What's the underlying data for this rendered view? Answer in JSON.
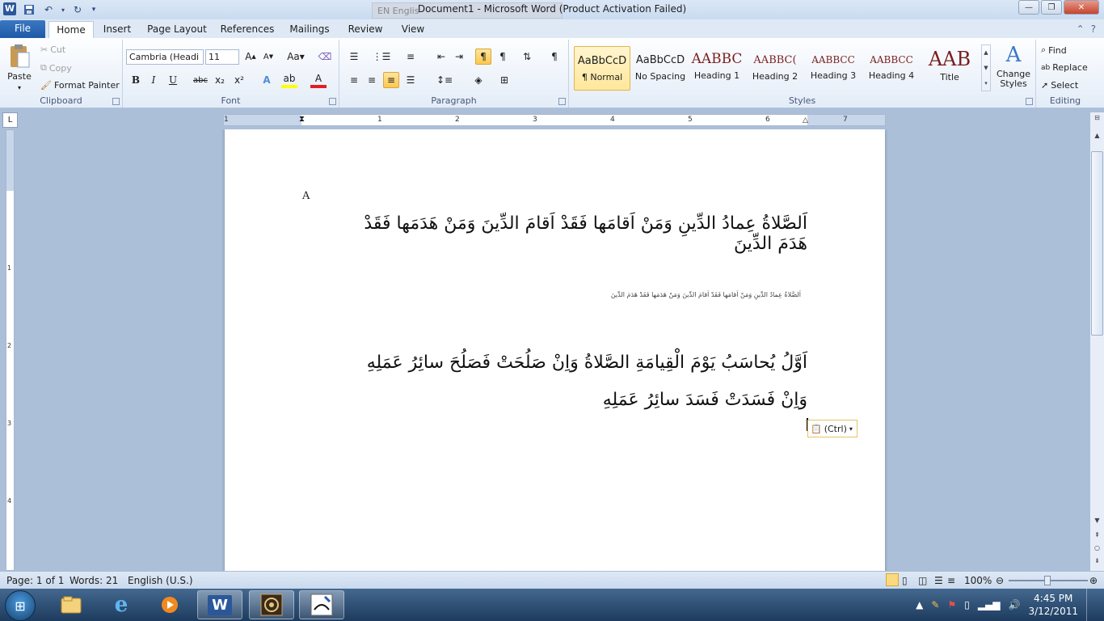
{
  "window": {
    "title": "Document1  -  Microsoft Word (Product Activation Failed)",
    "app_icon_letter": "W",
    "langbar_text": "EN Englis"
  },
  "tabs": [
    "File",
    "Home",
    "Insert",
    "Page Layout",
    "References",
    "Mailings",
    "Review",
    "View"
  ],
  "ribbon": {
    "clipboard": {
      "label": "Clipboard",
      "paste": "Paste",
      "cut": "Cut",
      "copy": "Copy",
      "format_painter": "Format Painter"
    },
    "font": {
      "label": "Font",
      "font_name": "Cambria (Headi",
      "font_size": "11"
    },
    "paragraph": {
      "label": "Paragraph"
    },
    "styles": {
      "label": "Styles",
      "tiles": [
        {
          "sample": "AaBbCcD",
          "name": "¶ Normal"
        },
        {
          "sample": "AaBbCcD",
          "name": "No Spacing"
        },
        {
          "sample": "AABBC",
          "name": "Heading 1"
        },
        {
          "sample": "AABBC(",
          "name": "Heading 2"
        },
        {
          "sample": "AABBCC",
          "name": "Heading 3"
        },
        {
          "sample": "AABBCC",
          "name": "Heading 4"
        },
        {
          "sample": "AAB",
          "name": "Title"
        }
      ],
      "change_styles": "Change Styles"
    },
    "editing": {
      "label": "Editing",
      "find": "Find",
      "replace": "Replace",
      "select": "Select"
    }
  },
  "ruler": {
    "numbers": [
      "1",
      "1",
      "2",
      "3",
      "4",
      "5",
      "6",
      "7"
    ],
    "vnumbers": [
      "1",
      "2",
      "3",
      "4"
    ]
  },
  "document": {
    "line_a": "A",
    "arabic_1": "اَلصَّلاةُ عِمادُ الدِّينِ وَمَنْ اَقامَها فَقَدْ اَقامَ الدِّينَ وَمَنْ هَدَمَها فَقَدْ هَدَمَ الدِّينَ",
    "arabic_2": "اَلصَّلاةُ عِمادُ الدِّينِ وَمَنْ اَقامَها فَقَدْ اَقامَ الدِّينَ وَمَنْ هَدَمَها فَقَدْ هَدَمَ الدِّينَ",
    "arabic_3": "اَوَّلُ يُحاسَبُ يَوْمَ الْقِيامَةِ الصَّلاةُ وَاِنْ صَلُحَتْ فَصَلُحَ سائِرُ عَمَلِهِ وَاِنْ فَسَدَتْ فَسَدَ سائِرُ عَمَلِهِ",
    "paste_options": "(Ctrl)"
  },
  "status": {
    "page": "Page: 1 of 1",
    "words": "Words: 21",
    "language": "English (U.S.)",
    "zoom": "100%"
  },
  "taskbar": {
    "time": "4:45 PM",
    "date": "3/12/2011"
  }
}
